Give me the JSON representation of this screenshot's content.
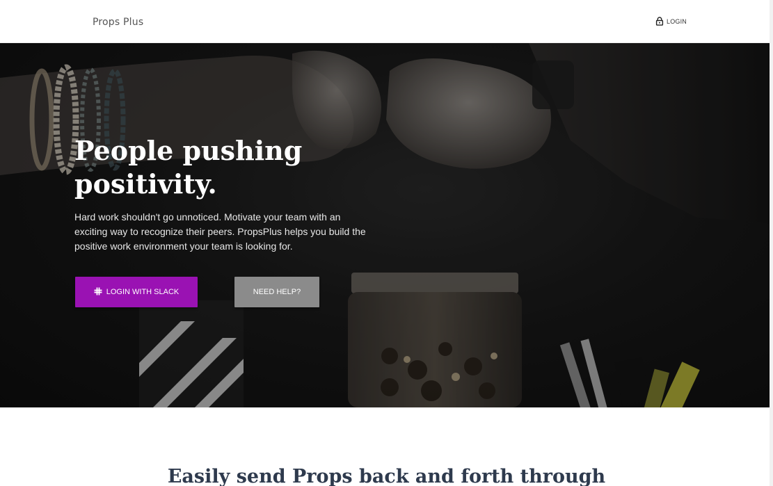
{
  "header": {
    "brand": "Props Plus",
    "login_label": "LOGIN",
    "login_icon": "lock-icon"
  },
  "hero": {
    "headline_line1": "People pushing",
    "headline_line2": "positivity.",
    "subtext": "Hard work shouldn't go unnoticed. Motivate your team with an exciting way to recognize their peers. PropsPlus helps you build the positive work environment your team is looking for.",
    "primary_button": {
      "label": "LOGIN WITH SLACK",
      "icon": "slack-icon",
      "color": "#9a12b3"
    },
    "secondary_button": {
      "label": "NEED HELP?",
      "color": "#8b8b8b"
    }
  },
  "features": {
    "title": "Easily send Props back and forth through"
  },
  "colors": {
    "accent": "#9a12b3",
    "heading_dark": "#2e3a4d"
  }
}
